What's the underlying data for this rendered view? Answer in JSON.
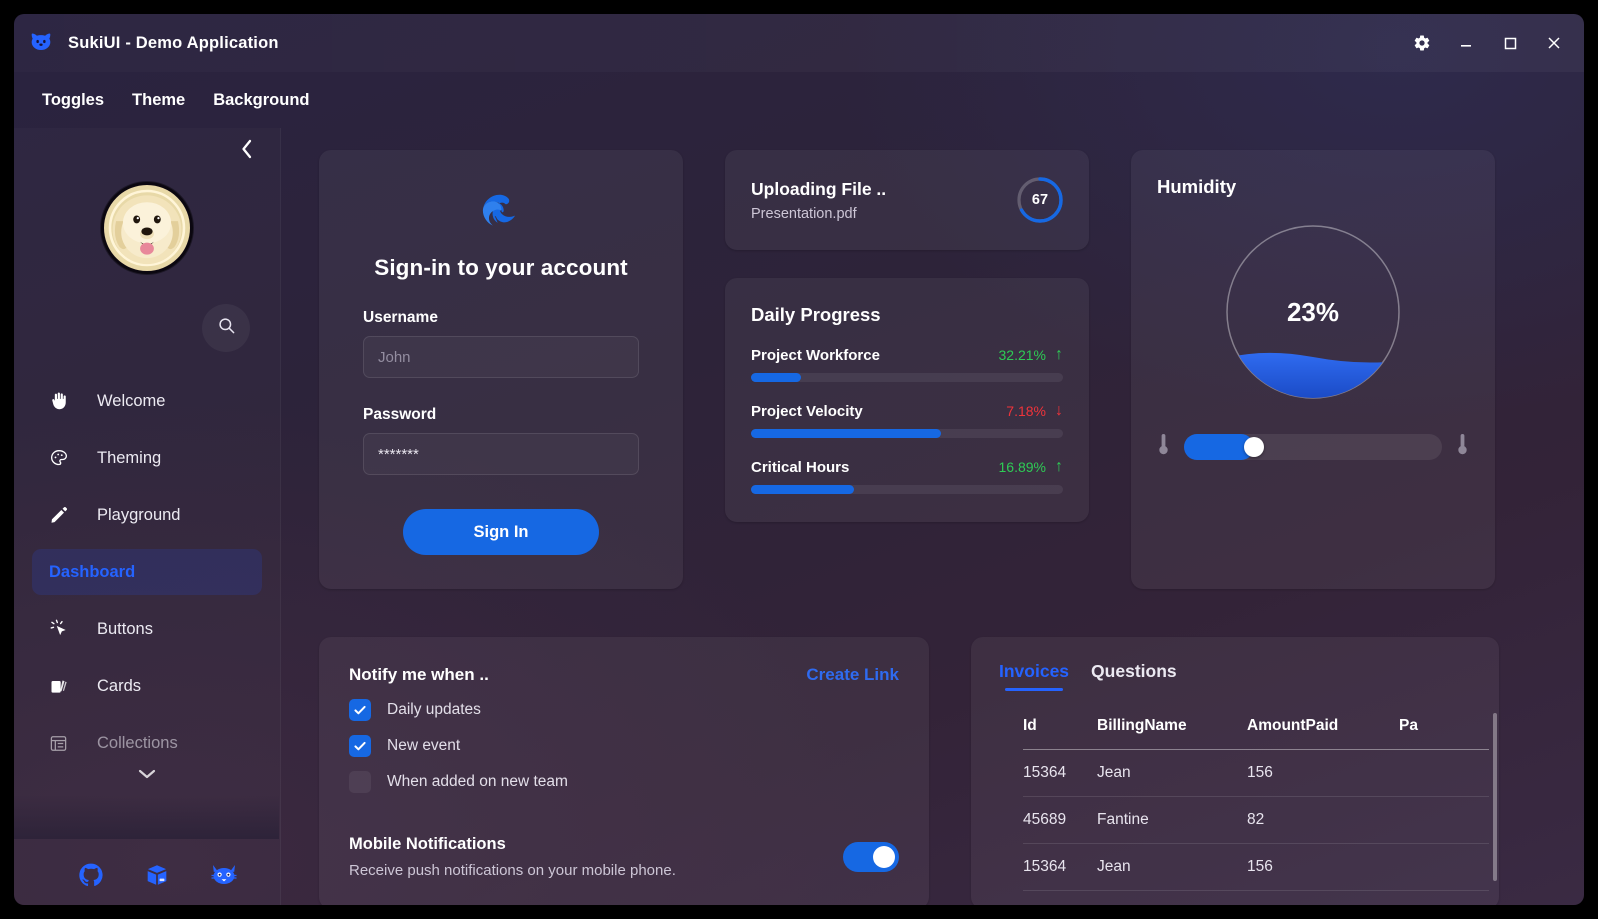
{
  "window": {
    "title": "SukiUI - Demo Application",
    "logo_icon": "dog-logo-icon",
    "controls": [
      {
        "name": "settings-button",
        "icon": "gear-icon"
      },
      {
        "name": "minimize-button",
        "icon": "minimize-icon"
      },
      {
        "name": "maximize-button",
        "icon": "maximize-icon"
      },
      {
        "name": "close-button",
        "icon": "close-icon"
      }
    ]
  },
  "menubar": {
    "items": [
      {
        "label": "Toggles"
      },
      {
        "label": "Theme"
      },
      {
        "label": "Background"
      }
    ]
  },
  "sidebar": {
    "collapse_icon": "chevron-left-icon",
    "avatar_icon": "dog-avatar",
    "search_icon": "search-icon",
    "scroll_icon": "chevron-down-icon",
    "items": [
      {
        "label": "Welcome",
        "icon": "waving-hand-icon",
        "active": false
      },
      {
        "label": "Theming",
        "icon": "palette-icon",
        "active": false
      },
      {
        "label": "Playground",
        "icon": "pencil-icon",
        "active": false
      },
      {
        "label": "Dashboard",
        "icon": "",
        "active": true
      },
      {
        "label": "Buttons",
        "icon": "cursor-click-icon",
        "active": false
      },
      {
        "label": "Cards",
        "icon": "cards-icon",
        "active": false
      },
      {
        "label": "Collections",
        "icon": "list-grid-icon",
        "active": false
      }
    ],
    "social": [
      {
        "name": "github-icon"
      },
      {
        "name": "nuget-box-icon"
      },
      {
        "name": "gitea-cat-icon"
      }
    ]
  },
  "signin": {
    "logo_icon": "edge-browser-icon",
    "heading": "Sign-in to your account",
    "username_label": "Username",
    "username_placeholder": "John",
    "username_value": "",
    "password_label": "Password",
    "password_value": "*******",
    "submit_label": "Sign In"
  },
  "upload": {
    "title": "Uploading File ..",
    "filename": "Presentation.pdf",
    "progress": 67,
    "progress_label": "67",
    "accent": "#1668e3"
  },
  "daily_progress": {
    "title": "Daily Progress",
    "items": [
      {
        "name": "Project Workforce",
        "delta": "32.21%",
        "direction": "up",
        "color": "#2ecb55",
        "arrow": "↑",
        "fill": 16
      },
      {
        "name": "Project Velocity",
        "delta": "7.18%",
        "direction": "down",
        "color": "#f0333a",
        "arrow": "↓",
        "fill": 61
      },
      {
        "name": "Critical Hours",
        "delta": "16.89%",
        "direction": "up",
        "color": "#2ecb55",
        "arrow": "↑",
        "fill": 33
      }
    ]
  },
  "humidity": {
    "title": "Humidity",
    "value_label": "23%",
    "value": 23,
    "slider_value": 27,
    "left_icon": "thermometer-icon",
    "right_icon": "thermometer-icon",
    "fill_color": "#1e56d6"
  },
  "notify": {
    "title": "Notify me when ..",
    "create_link_label": "Create Link",
    "checkboxes": [
      {
        "label": "Daily updates",
        "checked": true
      },
      {
        "label": "New event",
        "checked": true
      },
      {
        "label": "When added on new team",
        "checked": false
      }
    ],
    "mobile_title": "Mobile Notifications",
    "mobile_sub": "Receive push notifications on your mobile phone.",
    "mobile_enabled": true
  },
  "invoices": {
    "tabs": [
      {
        "label": "Invoices",
        "active": true
      },
      {
        "label": "Questions",
        "active": false
      }
    ],
    "columns": [
      "Id",
      "BillingName",
      "AmountPaid",
      "Pa"
    ],
    "rows": [
      {
        "id": "15364",
        "billing_name": "Jean",
        "amount_paid": "156",
        "pa": ""
      },
      {
        "id": "45689",
        "billing_name": "Fantine",
        "amount_paid": "82",
        "pa": ""
      },
      {
        "id": "15364",
        "billing_name": "Jean",
        "amount_paid": "156",
        "pa": ""
      }
    ]
  }
}
